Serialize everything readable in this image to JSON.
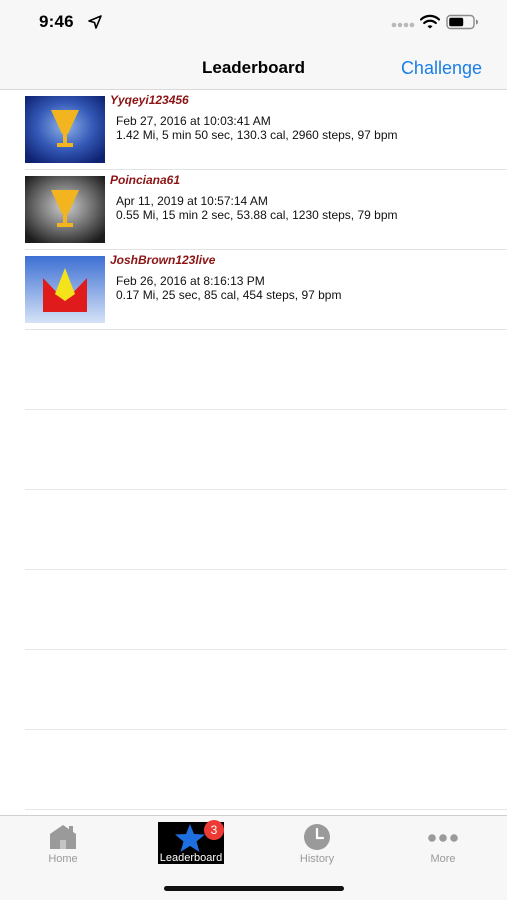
{
  "status_bar": {
    "time": "9:46",
    "icons": [
      "location-arrow-icon",
      "signal-icon",
      "wifi-icon",
      "battery-icon"
    ]
  },
  "nav": {
    "title": "Leaderboard",
    "action_label": "Challenge"
  },
  "leaderboard": [
    {
      "name": "Yyqeyi123456",
      "time": "Feb 27, 2016 at 10:03:41 AM",
      "detail": "1.42 Mi, 5 min 50 sec, 130.3 cal, 2960 steps, 97 bpm",
      "badge_icon": "gold-trophy-icon"
    },
    {
      "name": "Poinciana61",
      "time": "Apr 11, 2019 at 10:57:14 AM",
      "detail": "0.55 Mi, 15 min 2 sec, 53.88 cal, 1230 steps, 79 bpm",
      "badge_icon": "gold-trophy-icon"
    },
    {
      "name": "JoshBrown123live",
      "time": "Feb 26, 2016 at 8:16:13 PM",
      "detail": "0.17 Mi, 25 sec, 85 cal, 454 steps, 97 bpm",
      "badge_icon": "crown-icon"
    }
  ],
  "tabs": [
    {
      "label": "Home",
      "icon": "home-icon"
    },
    {
      "label": "Leaderboard",
      "icon": "star-icon",
      "badge": "3"
    },
    {
      "label": "History",
      "icon": "clock-icon"
    },
    {
      "label": "More",
      "icon": "more-icon"
    }
  ],
  "colors": {
    "accent": "#1a7ee8",
    "username": "#8b1414",
    "badge": "#ee3a35",
    "selected_tab_icon": "#1e6fe0"
  }
}
